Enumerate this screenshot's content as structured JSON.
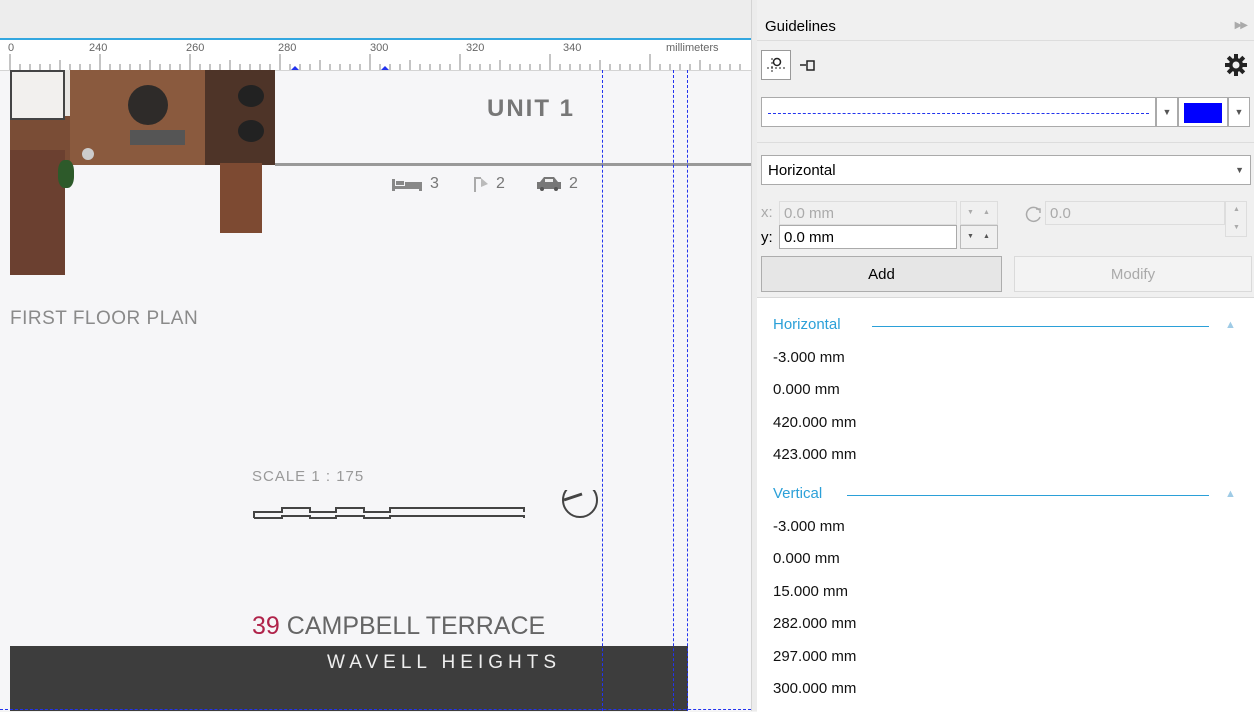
{
  "ruler": {
    "ticks": [
      "0",
      "240",
      "260",
      "280",
      "300",
      "320",
      "340"
    ],
    "units": "millimeters"
  },
  "canvas": {
    "unit_title": "UNIT 1",
    "features": [
      {
        "icon": "bed-icon",
        "count": "3"
      },
      {
        "icon": "shower-icon",
        "count": "2"
      },
      {
        "icon": "car-icon",
        "count": "2"
      }
    ],
    "floor_label": "FIRST FLOOR PLAN",
    "scale_label": "SCALE  1 : 175",
    "address_number": "39",
    "address_street": "CAMPBELL TERRACE",
    "suburb": "WAVELL HEIGHTS"
  },
  "panel": {
    "title": "Guidelines",
    "line_color": "#0000ff",
    "orientation": "Horizontal",
    "x_label": "x:",
    "x_value": "0.0 mm",
    "y_label": "y:",
    "y_value": "0.0 mm",
    "angle_value": "0.0",
    "add_label": "Add",
    "modify_label": "Modify",
    "groups": [
      {
        "name": "Horizontal",
        "items": [
          "-3.000 mm",
          "0.000 mm",
          "420.000 mm",
          "423.000 mm"
        ]
      },
      {
        "name": "Vertical",
        "items": [
          "-3.000 mm",
          "0.000 mm",
          "15.000 mm",
          "282.000 mm",
          "297.000 mm",
          "300.000 mm"
        ]
      }
    ]
  }
}
